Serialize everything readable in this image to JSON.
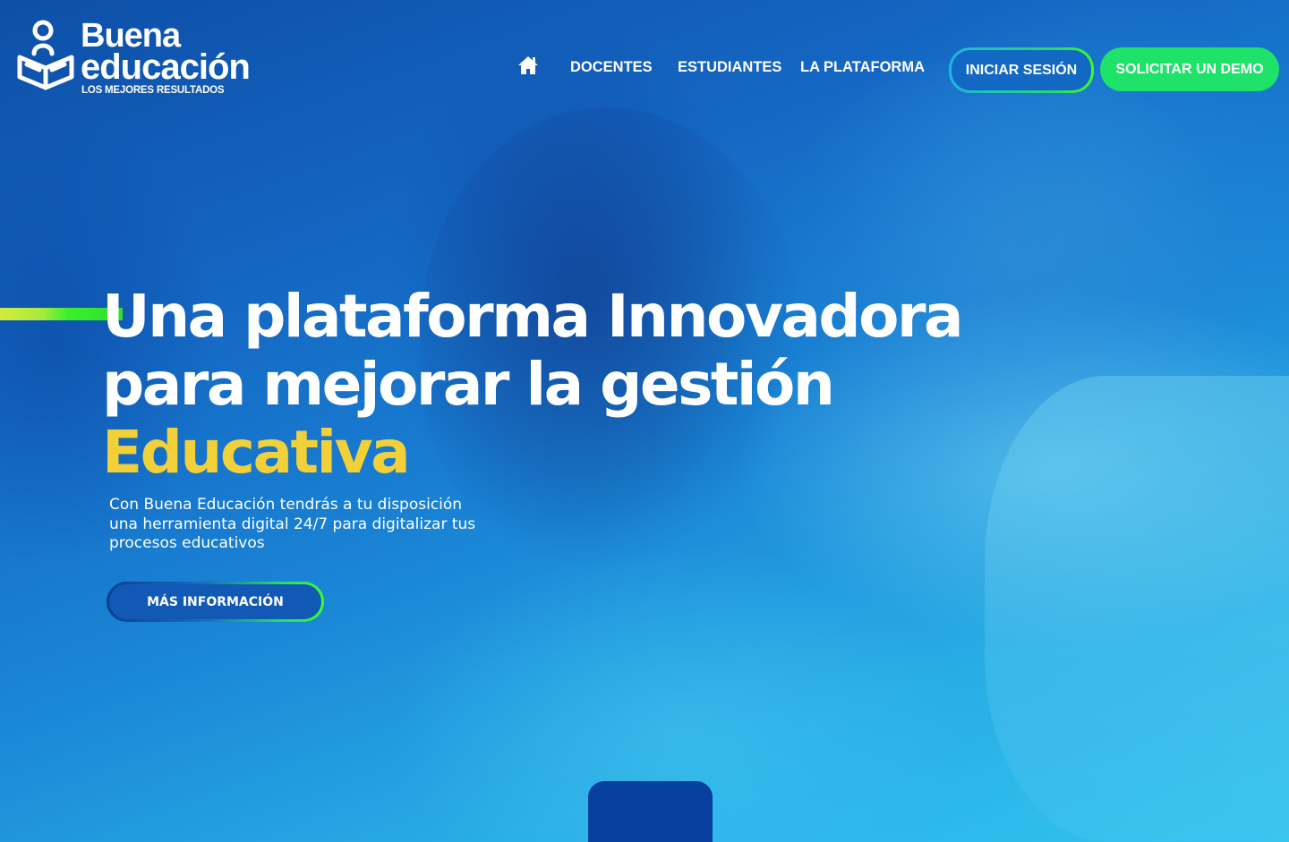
{
  "brand": {
    "line1": "Buena",
    "line2": "educación",
    "tagline": "LOS MEJORES RESULTADOS",
    "icon": "book-reader-logo-icon"
  },
  "nav": {
    "home_icon": "home-icon",
    "items": [
      {
        "label": "DOCENTES"
      },
      {
        "label": "ESTUDIANTES"
      },
      {
        "label": "LA PLATAFORMA"
      }
    ],
    "login_label": "INICIAR SESIÓN",
    "demo_label": "SOLICITAR UN DEMO"
  },
  "hero": {
    "title_line1": "Una plataforma Innovadora",
    "title_line2": "para mejorar la gestión",
    "title_highlight": "Educativa",
    "description": "Con Buena Educación tendrás a tu disposición una herramienta digital 24/7 para digitalizar tus procesos educativos",
    "cta_label": "MÁS INFORMACIÓN"
  },
  "colors": {
    "accent_yellow": "#f2d03a",
    "accent_green": "#1fe26a",
    "primary_blue": "#1268c3",
    "dark_blue": "#073f9e"
  }
}
